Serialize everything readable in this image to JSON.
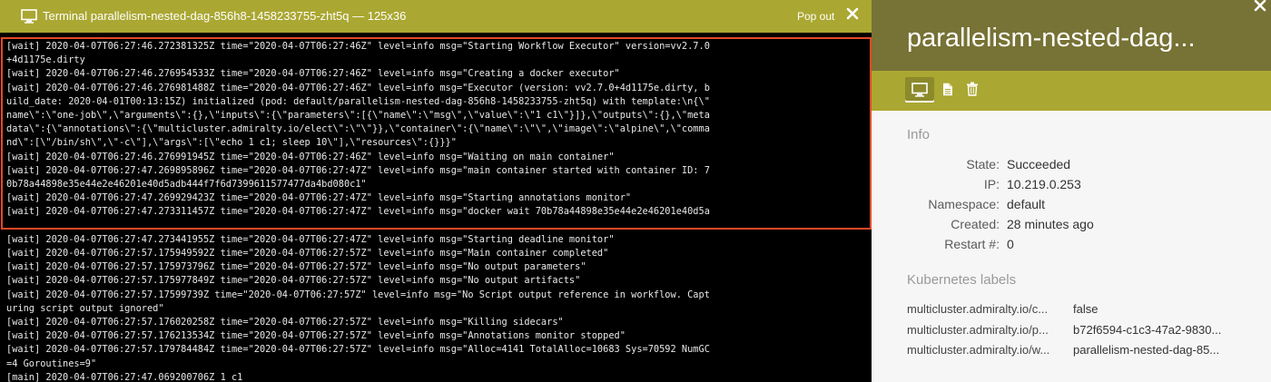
{
  "terminal": {
    "title": "Terminal parallelism-nested-dag-856h8-1458233755-zht5q — 125x36",
    "popout_label": "Pop out",
    "lines": [
      "[wait] 2020-04-07T06:27:46.272381325Z time=\"2020-04-07T06:27:46Z\" level=info msg=\"Starting Workflow Executor\" version=vv2.7.0",
      "+4d1175e.dirty",
      "[wait] 2020-04-07T06:27:46.276954533Z time=\"2020-04-07T06:27:46Z\" level=info msg=\"Creating a docker executor\"",
      "[wait] 2020-04-07T06:27:46.276981488Z time=\"2020-04-07T06:27:46Z\" level=info msg=\"Executor (version: vv2.7.0+4d1175e.dirty, b",
      "uild_date: 2020-04-01T00:13:15Z) initialized (pod: default/parallelism-nested-dag-856h8-1458233755-zht5q) with template:\\n{\\\"",
      "name\\\":\\\"one-job\\\",\\\"arguments\\\":{},\\\"inputs\\\":{\\\"parameters\\\":[{\\\"name\\\":\\\"msg\\\",\\\"value\\\":\\\"1 c1\\\"}]},\\\"outputs\\\":{},\\\"meta",
      "data\\\":{\\\"annotations\\\":{\\\"multicluster.admiralty.io/elect\\\":\\\"\\\"}},\\\"container\\\":{\\\"name\\\":\\\"\\\",\\\"image\\\":\\\"alpine\\\",\\\"comma",
      "nd\\\":[\\\"/bin/sh\\\",\\\"-c\\\"],\\\"args\\\":[\\\"echo 1 c1; sleep 10\\\"],\\\"resources\\\":{}}}\"",
      "[wait] 2020-04-07T06:27:46.276991945Z time=\"2020-04-07T06:27:46Z\" level=info msg=\"Waiting on main container\"",
      "[wait] 2020-04-07T06:27:47.269895896Z time=\"2020-04-07T06:27:47Z\" level=info msg=\"main container started with container ID: 7",
      "0b78a44898e35e44e2e46201e40d5adb444f7f6d7399611577477da4bd080c1\"",
      "[wait] 2020-04-07T06:27:47.269929423Z time=\"2020-04-07T06:27:47Z\" level=info msg=\"Starting annotations monitor\"",
      "[wait] 2020-04-07T06:27:47.273311457Z time=\"2020-04-07T06:27:47Z\" level=info msg=\"docker wait 70b78a44898e35e44e2e46201e40d5a",
      "",
      "[wait] 2020-04-07T06:27:47.273441955Z time=\"2020-04-07T06:27:47Z\" level=info msg=\"Starting deadline monitor\"",
      "[wait] 2020-04-07T06:27:57.175949592Z time=\"2020-04-07T06:27:57Z\" level=info msg=\"Main container completed\"",
      "[wait] 2020-04-07T06:27:57.175973796Z time=\"2020-04-07T06:27:57Z\" level=info msg=\"No output parameters\"",
      "[wait] 2020-04-07T06:27:57.175977849Z time=\"2020-04-07T06:27:57Z\" level=info msg=\"No output artifacts\"",
      "[wait] 2020-04-07T06:27:57.17599739Z time=\"2020-04-07T06:27:57Z\" level=info msg=\"No Script output reference in workflow. Capt",
      "uring script output ignored\"",
      "[wait] 2020-04-07T06:27:57.176020258Z time=\"2020-04-07T06:27:57Z\" level=info msg=\"Killing sidecars\"",
      "[wait] 2020-04-07T06:27:57.176213534Z time=\"2020-04-07T06:27:57Z\" level=info msg=\"Annotations monitor stopped\"",
      "[wait] 2020-04-07T06:27:57.179784484Z time=\"2020-04-07T06:27:57Z\" level=info msg=\"Alloc=4141 TotalAlloc=10683 Sys=70592 NumGC",
      "=4 Goroutines=9\"",
      "[main] 2020-04-07T06:27:47.069200706Z 1 c1"
    ]
  },
  "details": {
    "title": "parallelism-nested-dag...",
    "info_heading": "Info",
    "info": [
      {
        "label": "State:",
        "value": "Succeeded"
      },
      {
        "label": "IP:",
        "value": "10.219.0.253"
      },
      {
        "label": "Namespace:",
        "value": "default"
      },
      {
        "label": "Created:",
        "value": "28 minutes ago"
      },
      {
        "label": "Restart #:",
        "value": "0"
      }
    ],
    "labels_heading": "Kubernetes labels",
    "labels": [
      {
        "key": "multicluster.admiralty.io/c...",
        "value": "false"
      },
      {
        "key": "multicluster.admiralty.io/p...",
        "value": "b72f6594-c1c3-47a2-9830..."
      },
      {
        "key": "multicluster.admiralty.io/w...",
        "value": "parallelism-nested-dag-85..."
      }
    ]
  },
  "icons": {
    "terminal_header": "monitor-icon",
    "popout_close": "close-icon",
    "panel_close": "close-icon",
    "toolbar": [
      "monitor-icon",
      "document-icon",
      "trash-icon"
    ]
  },
  "colors": {
    "terminal_header": "#aaa732",
    "details_header": "#777235",
    "highlight_border": "#e64828"
  }
}
